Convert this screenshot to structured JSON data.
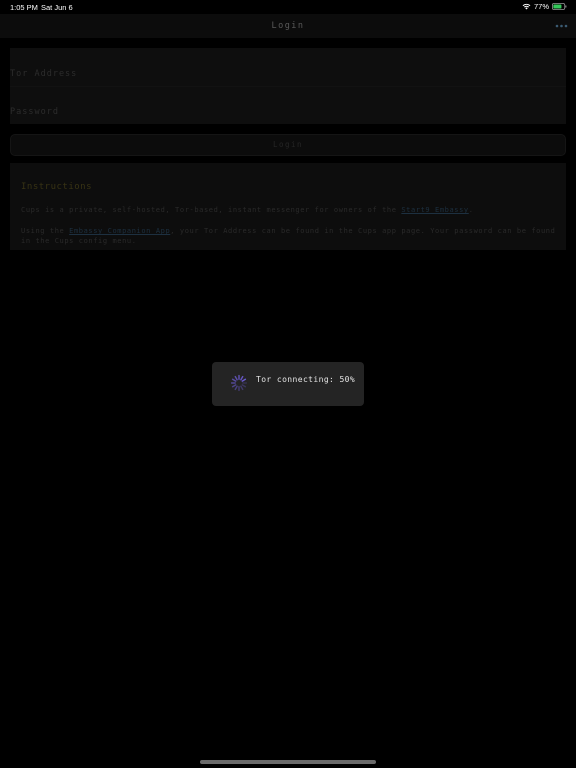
{
  "status_bar": {
    "time": "1:05 PM",
    "date": "Sat Jun 6",
    "battery_percent": "77%",
    "battery_level": 0.77,
    "battery_color": "#34c759"
  },
  "nav": {
    "title": "Login",
    "more_icon": "ellipsis-icon",
    "accent_color": "#3b5b73"
  },
  "form": {
    "tor_address_placeholder": "Tor Address",
    "tor_address_value": "",
    "password_placeholder": "Password",
    "password_value": ""
  },
  "login_button": {
    "label": "Login"
  },
  "instructions": {
    "title": "Instructions",
    "para1_before": "Cups is a private, self-hosted, Tor-based, instant messenger for owners of the ",
    "para1_link": "Start9 Embassy",
    "para1_after": ".",
    "para2_before": "Using the ",
    "para2_link": "Embassy Companion App",
    "para2_after": ", your Tor Address can be found in the Cups app page. Your password can be found in the Cups config menu."
  },
  "toast": {
    "message": "Tor connecting: 50%",
    "progress": 0.5,
    "spinner_icon": "spinner-icon",
    "spinner_color": "#6a5acd"
  }
}
